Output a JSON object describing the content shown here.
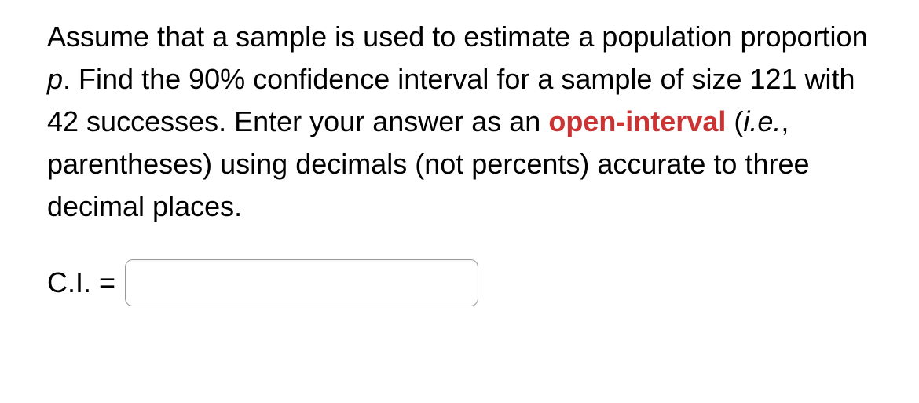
{
  "question": {
    "part1": "Assume that a sample is used to estimate a population proportion ",
    "p": "p",
    "part2": ". Find the 90% confidence interval for a sample of size 121 with 42 successes. Enter your answer as an ",
    "emphasis": "open-interval",
    "part3": " (",
    "ie": "i.e.",
    "part4": ", parentheses) using decimals (not percents) accurate to three decimal places."
  },
  "answer": {
    "label": "C.I. = ",
    "value": ""
  }
}
